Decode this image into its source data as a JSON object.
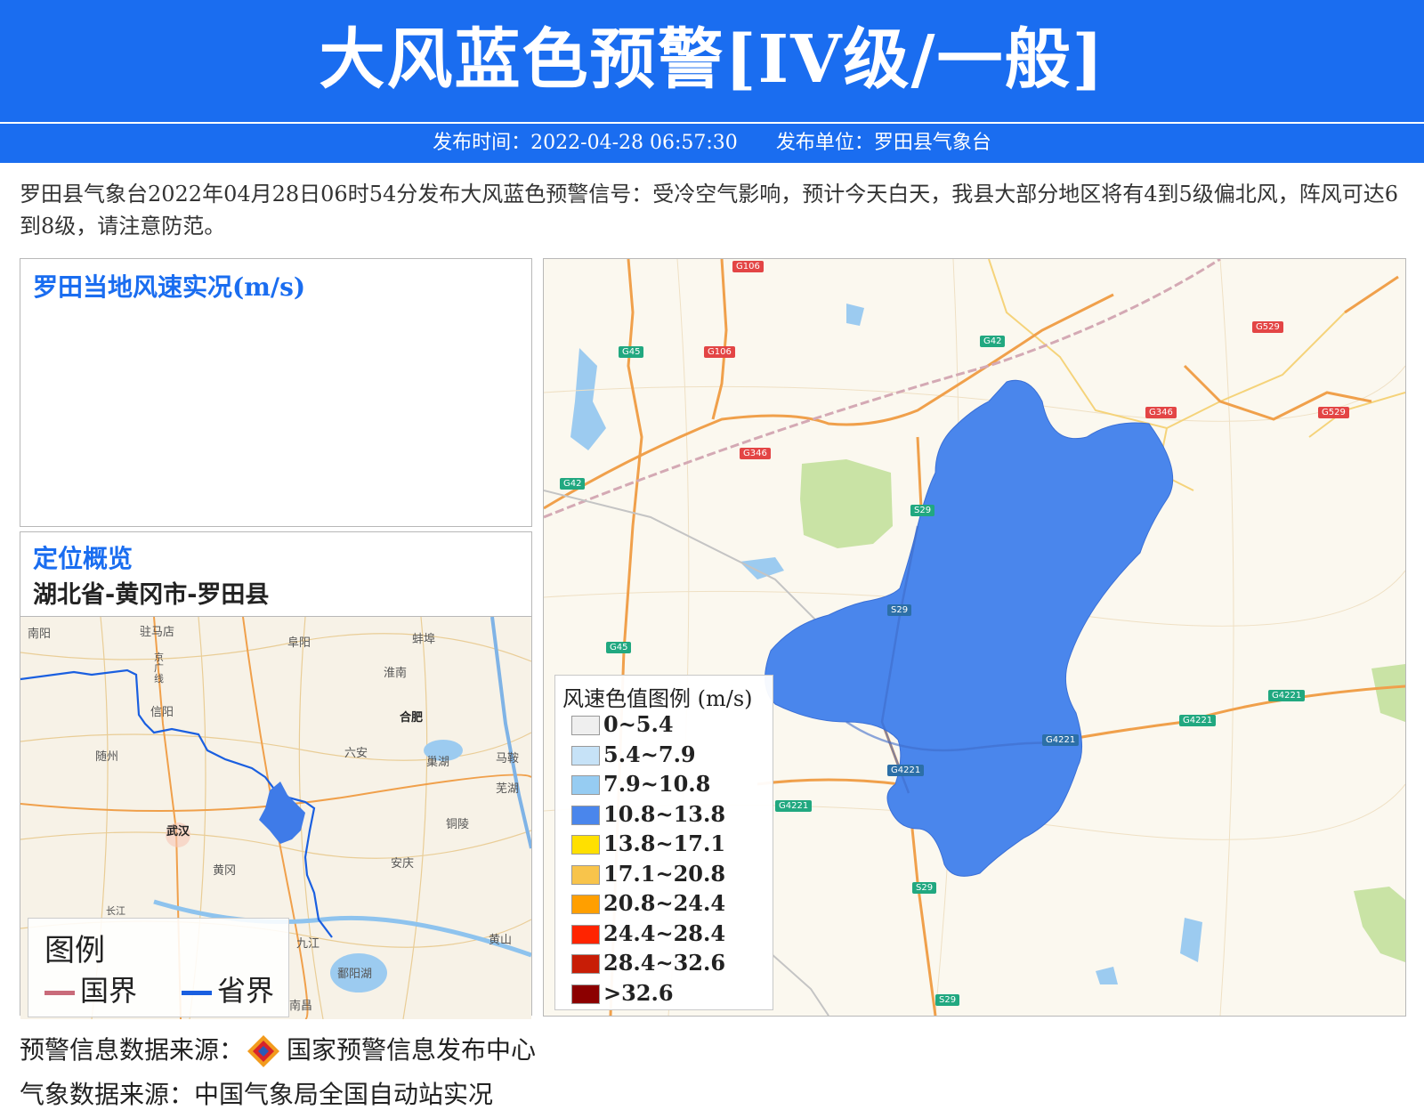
{
  "header": {
    "title": "大风蓝色预警[IV级/一般]",
    "publish_time": "发布时间：2022-04-28 06:57:30",
    "publisher": "发布单位：罗田县气象台"
  },
  "summary": "罗田县气象台2022年04月28日06时54分发布大风蓝色预警信号：受冷空气影响，预计今天白天，我县大部分地区将有4到5级偏北风，阵风可达6到8级，请注意防范。",
  "wind_panel": {
    "title": "罗田当地风速实况(m/s)"
  },
  "location_panel": {
    "title": "定位概览",
    "region": "湖北省-黄冈市-罗田县",
    "cities": [
      "南阳",
      "驻马店",
      "阜阳",
      "蚌埠",
      "信阳",
      "淮南",
      "合肥",
      "随州",
      "六安",
      "巢湖",
      "马鞍",
      "芜湖",
      "武汉",
      "铜陵",
      "黄冈",
      "安庆",
      "九江",
      "黄山",
      "鄱阳湖",
      "南昌",
      "京广线",
      "长江"
    ],
    "legend": {
      "title": "图例",
      "national_border": "国界",
      "provincial_border": "省界"
    },
    "colors": {
      "national_border": "#c96b7a",
      "provincial_border": "#1a5fe0",
      "county_fill": "#3f7be8"
    }
  },
  "main_map": {
    "county_fill_color": "#4a86ec",
    "road_labels": [
      "G106",
      "G106",
      "G45",
      "G42",
      "G529",
      "G529",
      "G346",
      "G346",
      "G42",
      "S29",
      "S29",
      "G45",
      "G4221",
      "G4221",
      "G4221",
      "G4221",
      "G4221",
      "S29",
      "S29"
    ],
    "wind_legend": {
      "title": "风速色值图例 (m/s)",
      "items": [
        {
          "label": "0~5.4",
          "color": "#efefef"
        },
        {
          "label": "5.4~7.9",
          "color": "#c6e2f7"
        },
        {
          "label": "7.9~10.8",
          "color": "#96ccf2"
        },
        {
          "label": "10.8~13.8",
          "color": "#4a86ec"
        },
        {
          "label": "13.8~17.1",
          "color": "#ffe000"
        },
        {
          "label": "17.1~20.8",
          "color": "#f8c44b"
        },
        {
          "label": "20.8~24.4",
          "color": "#ff9f00"
        },
        {
          "label": "24.4~28.4",
          "color": "#ff2400"
        },
        {
          "label": "28.4~32.6",
          "color": "#c81d06"
        },
        {
          "label": ">32.6",
          "color": "#8c0000"
        }
      ]
    }
  },
  "sources": {
    "warning_source": "预警信息数据来源：",
    "warning_source_name": "国家预警信息发布中心",
    "weather_source": "气象数据来源：中国气象局全国自动站实况"
  }
}
